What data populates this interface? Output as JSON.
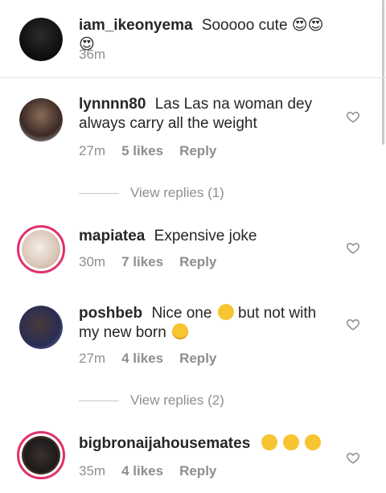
{
  "comments": [
    {
      "username": "iam_ikeonyema",
      "text": "Sooooo cute 😍😍😍",
      "time": "36m",
      "likes": "",
      "reply": ""
    },
    {
      "username": "lynnnn80",
      "text": "Las Las na woman dey always carry all the weight",
      "time": "27m",
      "likes": "5 likes",
      "reply": "Reply",
      "view_replies": "View replies (1)"
    },
    {
      "username": "mapiatea",
      "text": "Expensive joke",
      "time": "30m",
      "likes": "7 likes",
      "reply": "Reply"
    },
    {
      "username": "poshbeb",
      "text_before": "Nice one",
      "text_mid": "but not with my new born",
      "time": "27m",
      "likes": "4 likes",
      "reply": "Reply",
      "view_replies": "View replies (2)"
    },
    {
      "username": "bigbronaijahousemates",
      "time": "35m",
      "likes": "4 likes",
      "reply": "Reply"
    }
  ],
  "icons": {
    "heart": "heart-outline-icon",
    "clap": "clapping-hands-emoji",
    "eyeroll": "face-with-rolling-eyes-emoji",
    "wow": "face-with-open-mouth-emoji"
  },
  "colors": {
    "text": "#262626",
    "muted": "#8e8e8e",
    "story_ring": "#e1306c"
  }
}
